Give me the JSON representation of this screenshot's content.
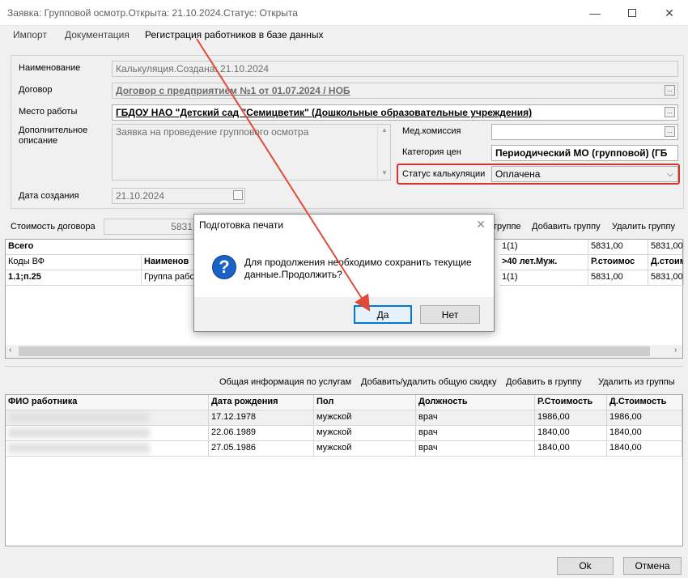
{
  "window": {
    "title": "Заявка: Групповой осмотр.Открыта: 21.10.2024.Статус: Открыта"
  },
  "menu": [
    "Импорт",
    "Документация",
    "Регистрация работников в базе данных"
  ],
  "form": {
    "name_label": "Наименование",
    "name_value": "Калькуляция.Создана: 21.10.2024",
    "contract_label": "Договор",
    "contract_value": "Договор с предприятием №1 от 01.07.2024 / НОБ",
    "workplace_label": "Место работы",
    "workplace_value": "ГБДОУ НАО \"Детский сад \"Семицветик\" (Дошкольные образовательные учреждения)",
    "description_label": "Дополнительное описание",
    "description_value": "Заявка на проведение группового осмотра",
    "commission_label": "Мед.комиссия",
    "commission_value": "",
    "price_category_label": "Категория цен",
    "price_category_value": "Периодический МО (групповой) (ГБ",
    "calc_status_label": "Статус калькуляции",
    "calc_status_value": "Оплачена",
    "created_label": "Дата создания",
    "created_value": "21.10.2024",
    "contract_cost_label": "Стоимость договора",
    "contract_cost_value": "5831"
  },
  "group_actions": [
    "группе",
    "Добавить группу",
    "Удалить группу"
  ],
  "group_grid": {
    "total_label": "Всего",
    "total_count": "1(1)",
    "total_r": "5831,00",
    "total_d": "5831,00",
    "headers": [
      "Коды ВФ",
      "Наименов",
      ">40 лет.Муж.",
      "Р.стоимос",
      "Д.стоимо"
    ],
    "row": [
      "1.1;п.25",
      "Группа рабо",
      "1(1)",
      "5831,00",
      "5831,00"
    ]
  },
  "worker_actions": [
    "Общая информация по услугам",
    "Добавить/удалить общую скидку",
    "Добавить в группу",
    "Удалить из группы"
  ],
  "workers_grid": {
    "headers": [
      "ФИО работника",
      "Дата рождения",
      "Пол",
      "Должность",
      "Р.Стоимость",
      "Д.Стоимость"
    ],
    "rows": [
      [
        "17.12.1978",
        "мужской",
        "врач",
        "1986,00",
        "1986,00"
      ],
      [
        "22.06.1989",
        "мужской",
        "врач",
        "1840,00",
        "1840,00"
      ],
      [
        "27.05.1986",
        "мужской",
        "врач",
        "1840,00",
        "1840,00"
      ]
    ]
  },
  "footer": {
    "ok": "Ok",
    "cancel": "Отмена"
  },
  "dialog": {
    "title": "Подготовка печати",
    "message": "Для продолжения необходимо сохранить текущие данные.Продолжить?",
    "yes": "Да",
    "no": "Нет",
    "icon": "question-icon"
  },
  "colors": {
    "highlight_red": "#d9342b",
    "arrow_red": "#e04a3a",
    "focus_blue": "#0078d7"
  }
}
